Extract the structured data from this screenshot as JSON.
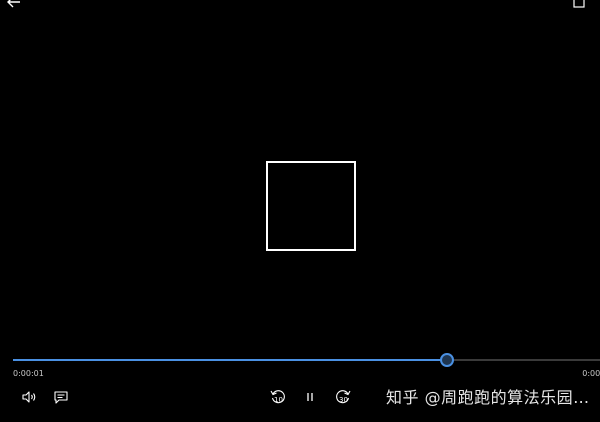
{
  "player": {
    "progress_fraction": 0.738,
    "current_time": "0:00:01",
    "total_time": "0:00:0",
    "skip_back_seconds": "10",
    "skip_forward_seconds": "30",
    "accent_color": "#4a90e2",
    "icons": {
      "back": "back-arrow-icon",
      "corner": "fullscreen-icon",
      "volume": "volume-icon",
      "subtitles": "subtitles-icon",
      "skip_back": "skip-back-icon",
      "pause": "pause-icon",
      "skip_forward": "skip-forward-icon"
    }
  },
  "watermark": {
    "text": "知乎 @周跑跑的算法乐园…"
  }
}
